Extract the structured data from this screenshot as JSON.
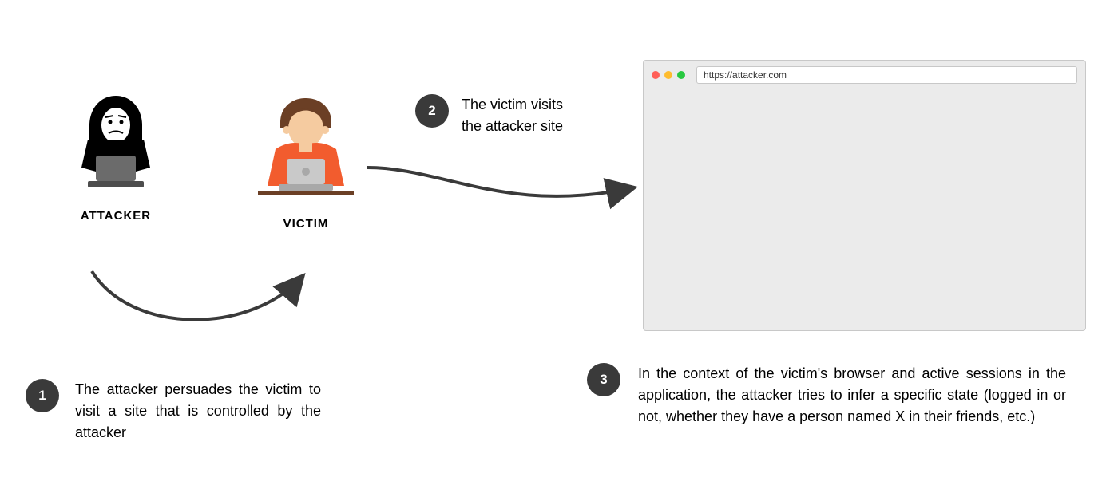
{
  "actors": {
    "attacker_label": "ATTACKER",
    "victim_label": "VICTIM"
  },
  "steps": {
    "s1": {
      "num": "1",
      "text": "The attacker persuades the victim to visit a site that is controlled by the attacker"
    },
    "s2": {
      "num": "2",
      "text": "The victim visits the attacker site"
    },
    "s3": {
      "num": "3",
      "text": "In the context of the victim's browser and active sessions in the application, the attacker tries to infer a specific state (logged in or not, whether they have a person named X in their friends, etc.)"
    }
  },
  "browser": {
    "url": "https://attacker.com"
  }
}
